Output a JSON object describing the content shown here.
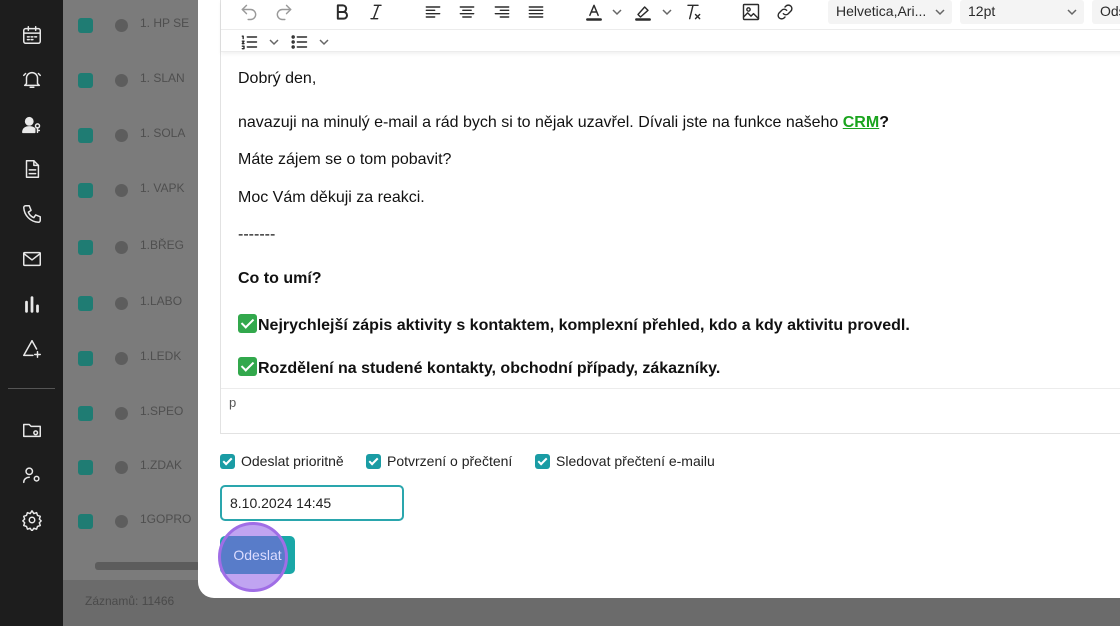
{
  "sidebar": {
    "icons": [
      "calendar-icon",
      "bell-icon",
      "user-key-icon",
      "document-icon",
      "phone-icon",
      "mail-icon",
      "chart-bar-icon",
      "triangle-add-icon",
      "folder-icon",
      "users-settings-icon",
      "gear-icon"
    ]
  },
  "background_list": {
    "rows": [
      "1. HP SE",
      "1. SLAN",
      "1. SOLA",
      "1. VAPK",
      "1.BŘEG",
      "1.LABO",
      "1.LEDK",
      "1.SPEO",
      "1.ZDAK",
      "1GOPRO"
    ],
    "footer": "Záznamů: 11466"
  },
  "toolbar": {
    "font_family": "Helvetica,Ari...",
    "font_size": "12pt",
    "overflow_label": "Ods"
  },
  "email": {
    "greeting": "Dobrý den,",
    "line1_before": "navazuji na minulý e-mail a rád bych si to nějak uzavřel. Dívali jste na funkce našeho ",
    "line1_link": "CRM",
    "line1_after": "?",
    "line2": "Máte zájem se o tom pobavit?",
    "line3": "Moc Vám děkuji za reakci.",
    "separator": "-------",
    "heading": "Co to umí?",
    "feature1": "Nejrychlejší zápis aktivity s kontaktem, komplexní přehled, kdo a kdy aktivitu provedl.",
    "feature2": "Rozdělení na studené kontakty, obchodní případy, zákazníky."
  },
  "statusbar": {
    "path": "p"
  },
  "options": {
    "priority": "Odeslat prioritně",
    "read_receipt": "Potvrzení o přečtení",
    "track_read": "Sledovat přečtení e-mailu"
  },
  "schedule": {
    "datetime": "8.10.2024 14:45"
  },
  "actions": {
    "send": "Odeslat"
  },
  "colors": {
    "accent": "#1a9ca4",
    "link_green": "#1aa41e",
    "sidebar_bg": "#1d1d1d"
  }
}
